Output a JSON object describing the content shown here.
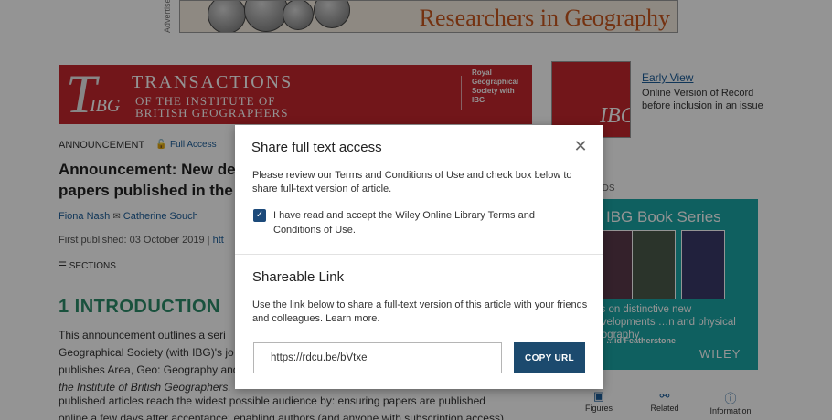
{
  "ad": {
    "side_label": "Advertisement",
    "title": "Researchers in Geography"
  },
  "journal": {
    "logo_letter": "T",
    "logo_ibg": "IBG",
    "line1": "TRANSACTIONS",
    "line2": "OF THE INSTITUTE OF",
    "line3": "BRITISH GEOGRAPHERS",
    "society": "Royal Geographical Society with IBG"
  },
  "sidebar": {
    "cover_ibg": "IBG",
    "early_view_label": "Early View",
    "early_view_desc": "Online Version of Record before inclusion in an issue",
    "books_label": "ADS",
    "book_series_title": "IBG Book Series",
    "book_series_desc": "…s on distinctive new developments …n and physical geography",
    "book_series_author": "…id Featherstone",
    "publisher": "WILEY"
  },
  "article": {
    "type": "ANNOUNCEMENT",
    "access": "Full Access",
    "title_line1": "Announcement: New de",
    "title_line2": "papers published in the",
    "author1": "Fiona Nash",
    "author2": "Catherine Souch",
    "published": "First published: 03 October 2019",
    "published_link": "htt",
    "sections_label": "SECTIONS",
    "intro_heading": "1 INTRODUCTION",
    "body": [
      "This announcement outlines a seri",
      "Geographical Society (with IBG)'s jo",
      "publishes Area, Geo: Geography and",
      "the Institute of British Geographers.",
      "published articles reach the widest possible audience by: ensuring papers are published",
      "online a few days after acceptance; enabling authors (and anyone with subscription access)"
    ]
  },
  "tools": {
    "figures": "Figures",
    "related": "Related",
    "information": "Information"
  },
  "modal": {
    "title": "Share full text access",
    "instructions": "Please review our Terms and Conditions of Use and check box below to share full-text version of article.",
    "consent_checked": true,
    "consent_text": "I have read and accept the Wiley Online Library Terms and Conditions of Use.",
    "share_heading": "Shareable Link",
    "share_desc": "Use the link below to share a full-text version of this article with your friends and colleagues. Learn more.",
    "share_url": "https://rdcu.be/bVtxe",
    "copy_label": "COPY URL"
  },
  "colors": {
    "journal_red": "#c4262e",
    "book_series_teal": "#1ba5a5",
    "intro_green": "#2c8c6a",
    "button_navy": "#1c4a6e",
    "link_blue": "#1c5d99"
  }
}
